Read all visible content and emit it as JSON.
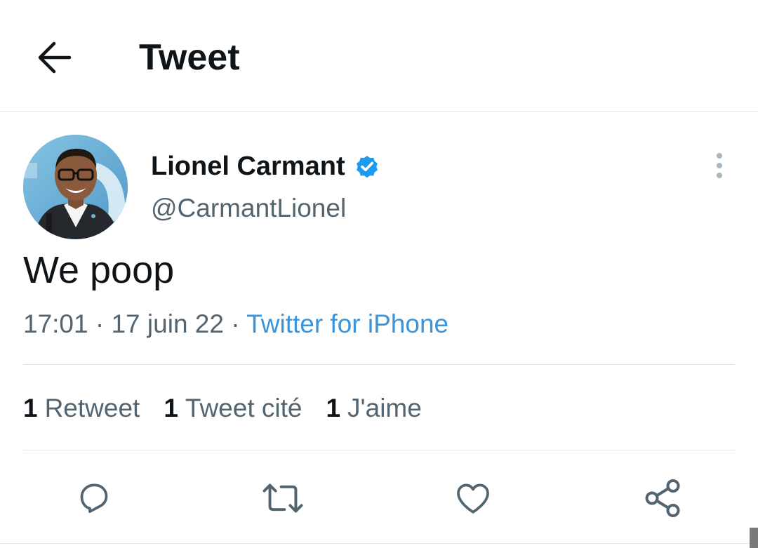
{
  "header": {
    "back_icon": "arrow-left-icon",
    "title": "Tweet"
  },
  "author": {
    "name": "Lionel Carmant",
    "handle": "@CarmantLionel",
    "verified_icon": "verified-badge-icon",
    "verified_color": "#1d9bf0"
  },
  "tweet": {
    "text": "We poop",
    "time": "17:01",
    "separator": "·",
    "date": "17 juin 22",
    "source": "Twitter for iPhone"
  },
  "stats": [
    {
      "count": "1",
      "label": "Retweet"
    },
    {
      "count": "1",
      "label": "Tweet cité"
    },
    {
      "count": "1",
      "label": "J'aime"
    }
  ],
  "actions": [
    "reply-icon",
    "retweet-icon",
    "like-icon",
    "share-icon"
  ],
  "colors": {
    "text_primary": "#0f1419",
    "text_secondary": "#536471",
    "link": "#3b94d9",
    "divider": "#dfe3e6",
    "icon": "#536471"
  }
}
